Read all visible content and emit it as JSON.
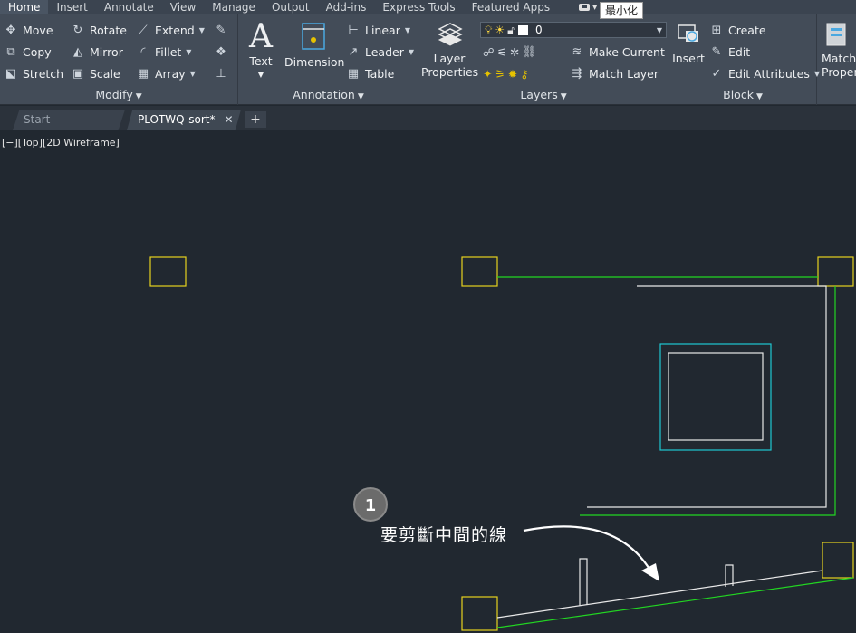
{
  "menu": {
    "tabs": [
      "Home",
      "Insert",
      "Annotate",
      "View",
      "Manage",
      "Output",
      "Add-ins",
      "Express Tools",
      "Featured Apps"
    ],
    "tooltip": "最小化"
  },
  "ribbon": {
    "modify": {
      "title": "Modify",
      "move": "Move",
      "rotate": "Rotate",
      "extend": "Extend",
      "copy": "Copy",
      "mirror": "Mirror",
      "fillet": "Fillet",
      "stretch": "Stretch",
      "scale": "Scale",
      "array": "Array"
    },
    "annotation": {
      "title": "Annotation",
      "text": "Text",
      "dimension": "Dimension",
      "linear": "Linear",
      "leader": "Leader",
      "table": "Table"
    },
    "layers": {
      "title": "Layers",
      "layer_properties": "Layer Properties",
      "current_layer": "0",
      "make_current": "Make Current",
      "match_layer": "Match Layer"
    },
    "block": {
      "title": "Block",
      "insert": "Insert",
      "create": "Create",
      "edit": "Edit",
      "edit_attributes": "Edit Attributes"
    },
    "properties": {
      "match_properties": "Match Properties"
    }
  },
  "document_tabs": {
    "start": "Start",
    "active": "PLOTWQ-sort*"
  },
  "viewport": {
    "label": "[−][Top][2D Wireframe]",
    "annotation_number": "1",
    "annotation_text": "要剪斷中間的線"
  },
  "colors": {
    "yellow": "#e6d21e",
    "green": "#22d622",
    "white": "#e8e8e8",
    "cyan": "#1ec8d2"
  }
}
